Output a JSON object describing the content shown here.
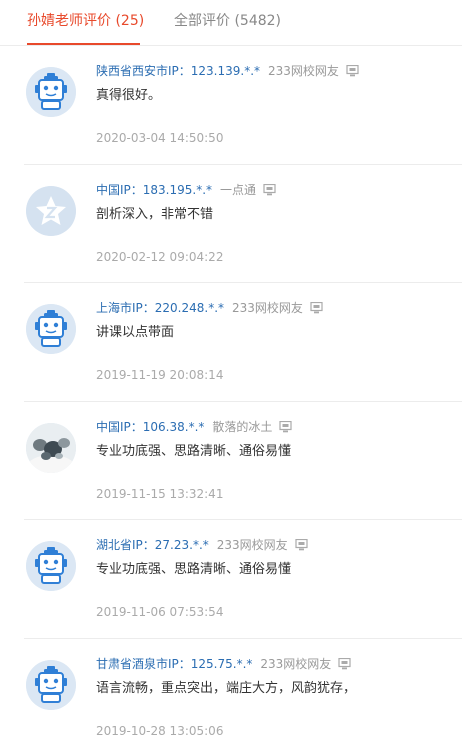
{
  "tabs": [
    {
      "label": "孙婧老师评价 (25)",
      "active": true
    },
    {
      "label": "全部评价 (5482)",
      "active": false
    }
  ],
  "reviews": [
    {
      "ip": "陕西省西安市IP：123.139.*.*",
      "nick": "233网校网友",
      "content": "真得很好。",
      "time": "2020-03-04 14:50:50",
      "avatar": "robot-avatar"
    },
    {
      "ip": "中国IP：183.195.*.*",
      "nick": "一点通",
      "content": "剖析深入，非常不错",
      "time": "2020-02-12 09:04:22",
      "avatar": "default-star-avatar"
    },
    {
      "ip": "上海市IP：220.248.*.*",
      "nick": "233网校网友",
      "content": "讲课以点带面",
      "time": "2019-11-19 20:08:14",
      "avatar": "robot-avatar"
    },
    {
      "ip": "中国IP：106.38.*.*",
      "nick": "散落的冰土",
      "content": "专业功底强、思路清晰、通俗易懂",
      "time": "2019-11-15 13:32:41",
      "avatar": "photo-avatar"
    },
    {
      "ip": "湖北省IP：27.23.*.*",
      "nick": "233网校网友",
      "content": "专业功底强、思路清晰、通俗易懂",
      "time": "2019-11-06 07:53:54",
      "avatar": "robot-avatar"
    },
    {
      "ip": "甘肃省酒泉市IP：125.75.*.*",
      "nick": "233网校网友",
      "content": "语言流畅，重点突出，端庄大方，风韵犹存，",
      "time": "2019-10-28 13:05:06",
      "avatar": "robot-avatar"
    }
  ],
  "colors": {
    "accent": "#e8492b",
    "ip": "#2b6db2",
    "muted": "#999999"
  }
}
